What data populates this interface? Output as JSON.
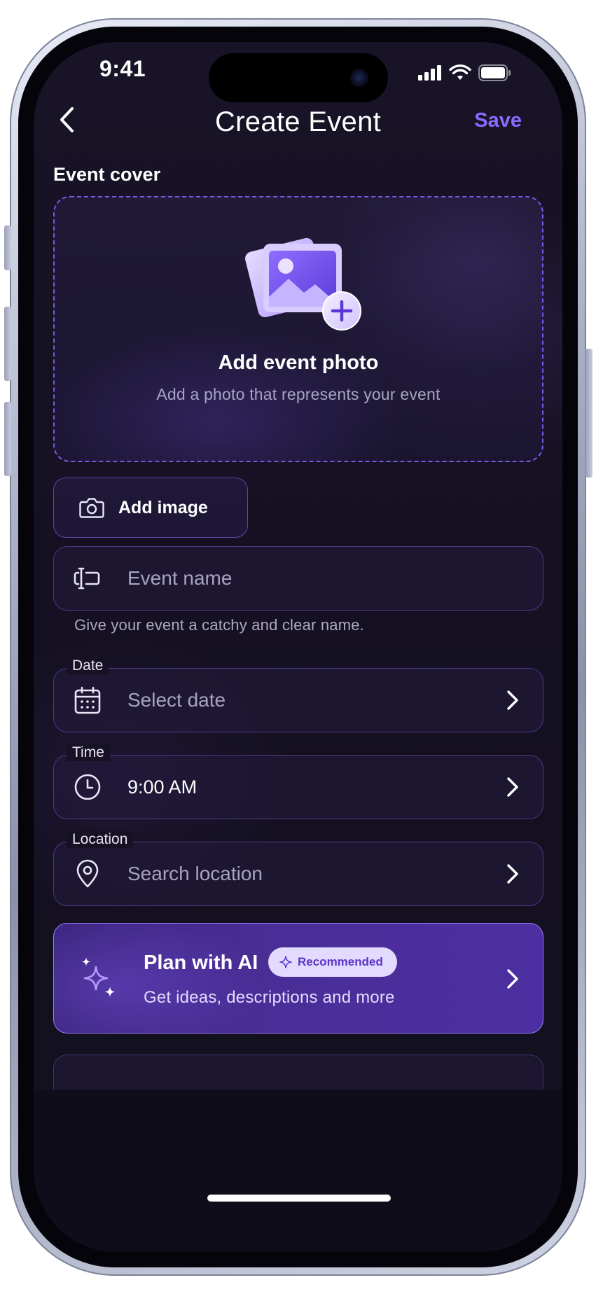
{
  "status_bar": {
    "time": "9:41"
  },
  "nav": {
    "title": "Create Event",
    "save_label": "Save"
  },
  "cover": {
    "section_label": "Event cover",
    "title": "Add event photo",
    "subtitle": "Add a photo that represents your event"
  },
  "add_image": {
    "label": "Add image"
  },
  "event_name": {
    "placeholder": "Event name",
    "helper": "Give your event a catchy and clear name."
  },
  "date": {
    "label": "Date",
    "placeholder": "Select date"
  },
  "time": {
    "label": "Time",
    "value": "9:00 AM"
  },
  "location": {
    "label": "Location",
    "placeholder": "Search location"
  },
  "ai_card": {
    "title": "Plan with AI",
    "badge": "Recommended",
    "subtitle": "Get ideas, descriptions and more"
  },
  "colors": {
    "accent": "#8a6bff",
    "background": "#151122",
    "ai_card": "#4a2e97",
    "badge_bg": "#e3dbff"
  },
  "icons": {
    "back": "chevron-left-icon",
    "cover": "image-plus-icon",
    "add_image": "camera-icon",
    "event_name": "text-cursor-icon",
    "date": "calendar-icon",
    "time": "clock-icon",
    "location": "map-pin-icon",
    "ai": "sparkles-icon",
    "chevron": "chevron-right-icon"
  }
}
